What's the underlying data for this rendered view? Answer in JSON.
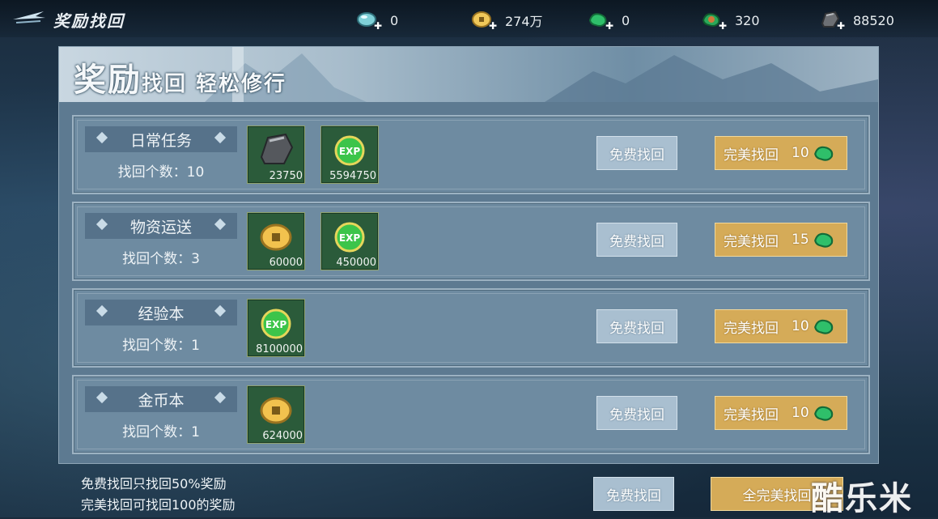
{
  "header": {
    "title": "奖励找回",
    "resources": [
      {
        "icon": "jade-orb-icon",
        "value": "0"
      },
      {
        "icon": "gold-coin-icon",
        "value": "274万"
      },
      {
        "icon": "green-jade-icon",
        "value": "0"
      },
      {
        "icon": "green-gem-icon",
        "value": "320"
      },
      {
        "icon": "ore-stone-icon",
        "value": "88520"
      }
    ]
  },
  "banner": {
    "title_big": "奖励",
    "title_small": "找回 轻松修行"
  },
  "rows": [
    {
      "name": "日常任务",
      "count": "找回个数：10",
      "items": [
        {
          "icon": "ore-stone-icon",
          "amount": "23750"
        },
        {
          "icon": "exp-orb-icon",
          "amount": "5594750"
        }
      ],
      "free_label": "免费找回",
      "perfect_label": "完美找回",
      "cost": "10"
    },
    {
      "name": "物资运送",
      "count": "找回个数：3",
      "items": [
        {
          "icon": "gold-coin-icon",
          "amount": "60000"
        },
        {
          "icon": "exp-orb-icon",
          "amount": "450000"
        }
      ],
      "free_label": "免费找回",
      "perfect_label": "完美找回",
      "cost": "15"
    },
    {
      "name": "经验本",
      "count": "找回个数：1",
      "items": [
        {
          "icon": "exp-orb-icon",
          "amount": "8100000"
        }
      ],
      "free_label": "免费找回",
      "perfect_label": "完美找回",
      "cost": "10"
    },
    {
      "name": "金币本",
      "count": "找回个数：1",
      "items": [
        {
          "icon": "gold-coin-icon",
          "amount": "624000"
        }
      ],
      "free_label": "免费找回",
      "perfect_label": "完美找回",
      "cost": "10"
    }
  ],
  "footer": {
    "note1": "免费找回只找回50%奖励",
    "note2": "完美找回可找回100的奖励",
    "free_all_label": "免费找回",
    "perfect_all_label": "全完美找回"
  },
  "watermark": "酷乐米",
  "colors": {
    "accent_gold": "#d5ab58",
    "button_blue": "#a9bfd0",
    "panel": "#5d7a91"
  }
}
